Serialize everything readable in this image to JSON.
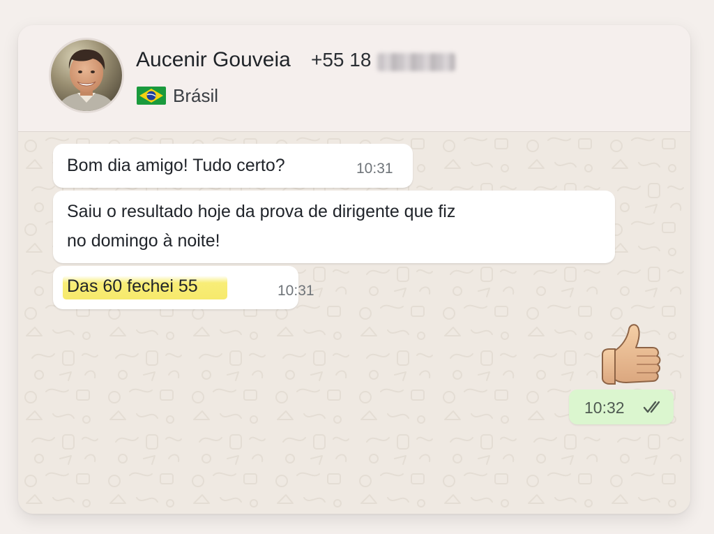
{
  "contact": {
    "name": "Aucenir Gouveia",
    "phone_visible": "+55 18",
    "country": "Brásil",
    "country_flag_icon": "brazil-flag-icon"
  },
  "messages": [
    {
      "direction": "incoming",
      "lines": [
        "Bom dia amigo! Tudo certo?"
      ],
      "time": "10:31"
    },
    {
      "direction": "incoming",
      "lines": [
        "Saiu o resultado hoje da prova de dirigente que fiz",
        "no domingo à noite!"
      ],
      "time": ""
    },
    {
      "direction": "incoming",
      "lines": [
        "Das 60 fechei 55"
      ],
      "time": "10:31",
      "highlighted": true
    },
    {
      "direction": "outgoing",
      "content_icon": "thumbs-up-emoji-icon",
      "time": "10:32",
      "status_icon": "double-check-icon"
    }
  ],
  "colors": {
    "page_background": "#f4efec",
    "header_background": "#f5efed",
    "chat_background": "#efe9e2",
    "incoming_bubble": "#ffffff",
    "outgoing_bubble": "#dbf6cf",
    "highlight": "#f6e86a"
  }
}
